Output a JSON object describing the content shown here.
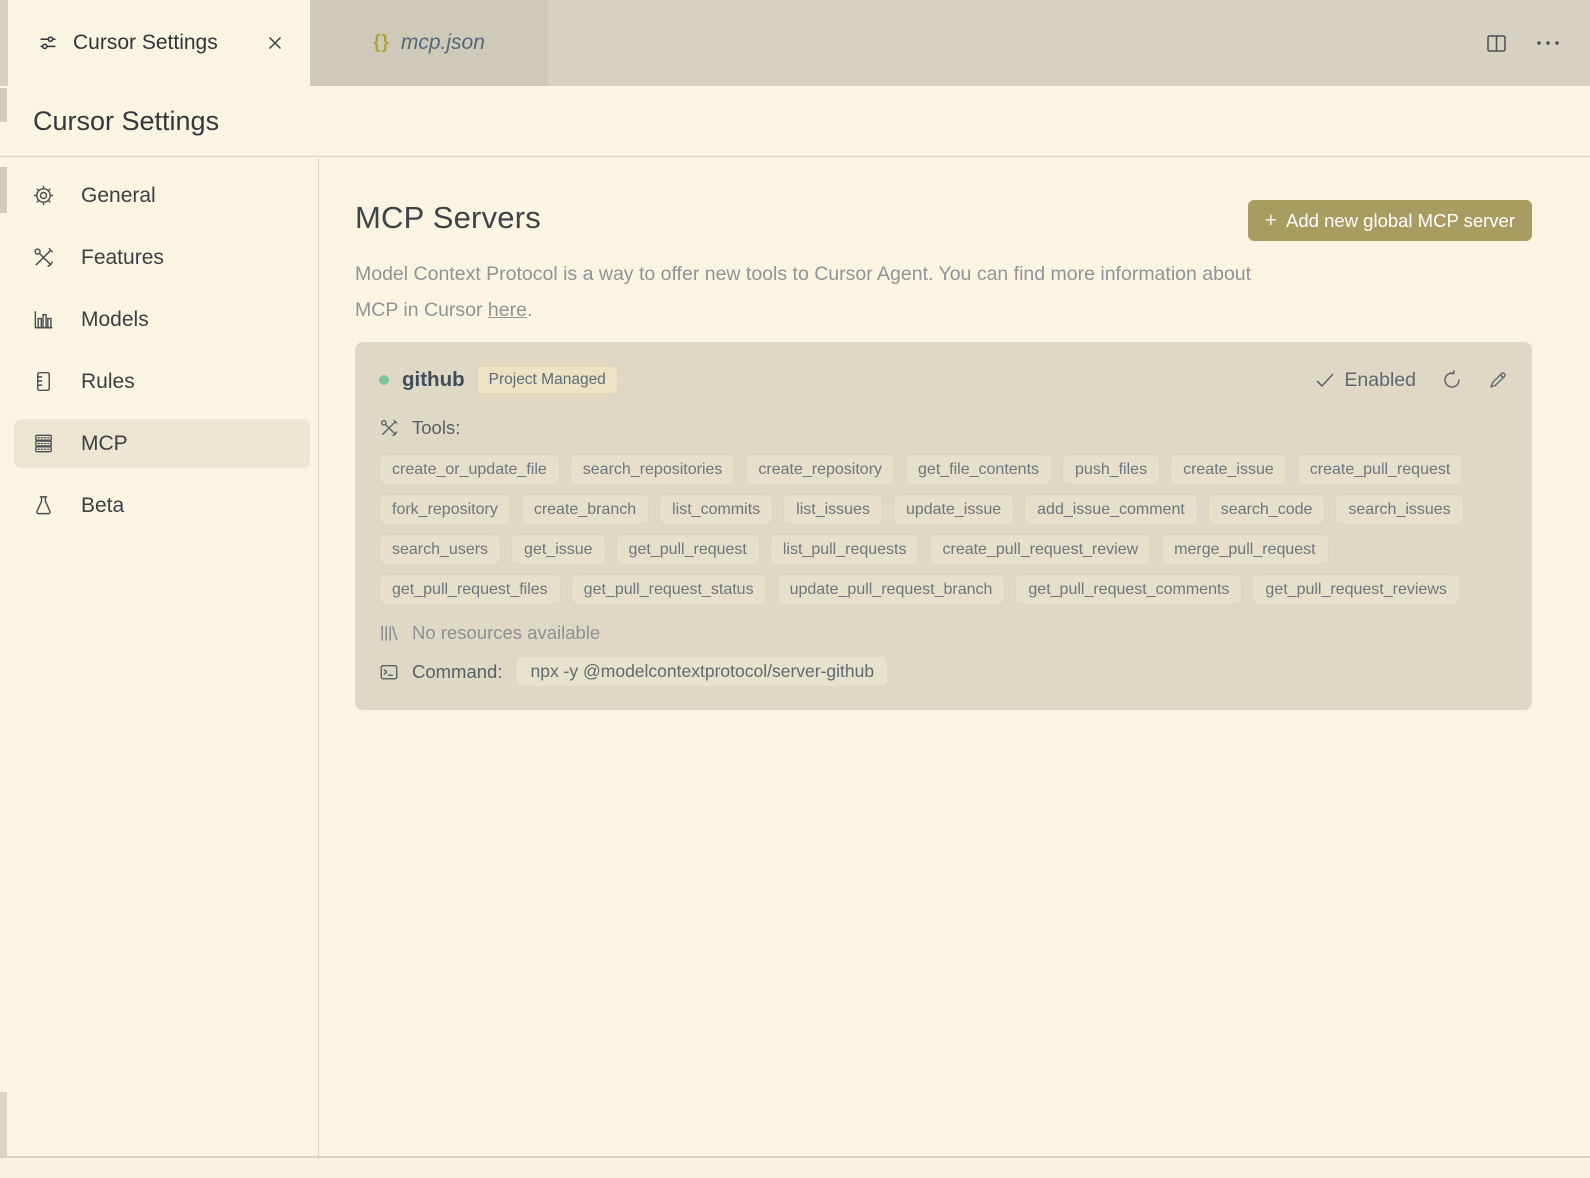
{
  "colors": {
    "page_bg": "#fbf4e2",
    "tab_strip_bg": "#d7d1c2",
    "inactive_tab_bg": "#cfc9b9",
    "card_bg": "#ded8c4",
    "accent_olive_button": "#a89c60",
    "json_brace_olive": "#b0a43e",
    "server_status_dot_green": "#7dc79c"
  },
  "tab_bar": {
    "settings_tab": {
      "label": "Cursor Settings",
      "icon": "sliders-icon",
      "close_icon": "close-icon"
    },
    "json_tab": {
      "label": "mcp.json",
      "icon_glyph": "{}"
    },
    "actions": {
      "split_editor_icon": "split-editor-icon",
      "more_icon": "ellipsis-icon"
    }
  },
  "page_header": {
    "title": "Cursor Settings"
  },
  "sidebar": {
    "items": [
      {
        "label": "General",
        "icon": "gear-icon"
      },
      {
        "label": "Features",
        "icon": "tools-icon"
      },
      {
        "label": "Models",
        "icon": "bar-chart-icon"
      },
      {
        "label": "Rules",
        "icon": "document-icon"
      },
      {
        "label": "MCP",
        "icon": "server-stack-icon",
        "selected": true
      },
      {
        "label": "Beta",
        "icon": "flask-icon"
      }
    ]
  },
  "main": {
    "heading": "MCP Servers",
    "add_server_button": {
      "plus": "+",
      "label": "Add new global MCP server"
    },
    "description": {
      "line1": "Model Context Protocol is a way to offer new tools to Cursor Agent. You can find more information about",
      "line2_before": "MCP in Cursor ",
      "link": "here",
      "line2_after": "."
    },
    "server": {
      "name": "github",
      "badge": "Project Managed",
      "status": "Enabled",
      "tools_label": "Tools:",
      "tools": [
        "create_or_update_file",
        "search_repositories",
        "create_repository",
        "get_file_contents",
        "push_files",
        "create_issue",
        "create_pull_request",
        "fork_repository",
        "create_branch",
        "list_commits",
        "list_issues",
        "update_issue",
        "add_issue_comment",
        "search_code",
        "search_issues",
        "search_users",
        "get_issue",
        "get_pull_request",
        "list_pull_requests",
        "create_pull_request_review",
        "merge_pull_request",
        "get_pull_request_files",
        "get_pull_request_status",
        "update_pull_request_branch",
        "get_pull_request_comments",
        "get_pull_request_reviews"
      ],
      "resources_text": "No resources available",
      "command_label": "Command:",
      "command": "npx -y @modelcontextprotocol/server-github"
    }
  }
}
